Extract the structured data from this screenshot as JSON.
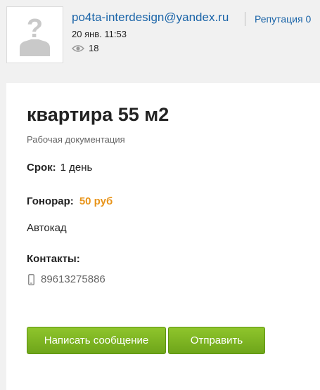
{
  "author": {
    "email": "po4ta-interdesign@yandex.ru",
    "reputation": "Репутация 0",
    "date": "20 янв. 11:53",
    "views": "18"
  },
  "icons": {
    "avatar": "default-user-avatar-icon",
    "views": "eye-icon",
    "phone": "mobile-phone-icon"
  },
  "job": {
    "title": "квартира 55 м2",
    "category": "Рабочая документация",
    "deadline_label": "Срок:",
    "deadline_value": "1 день",
    "fee_label": "Гонорар:",
    "fee_value": "50 руб",
    "software": "Автокад",
    "contacts_label": "Контакты:",
    "phone": "89613275886"
  },
  "actions": {
    "message": "Написать сообщение",
    "send": "Отправить"
  },
  "colors": {
    "link": "#1a64a8",
    "fee": "#e8941a",
    "button": "#7ab424",
    "background": "#f1f1f1"
  }
}
